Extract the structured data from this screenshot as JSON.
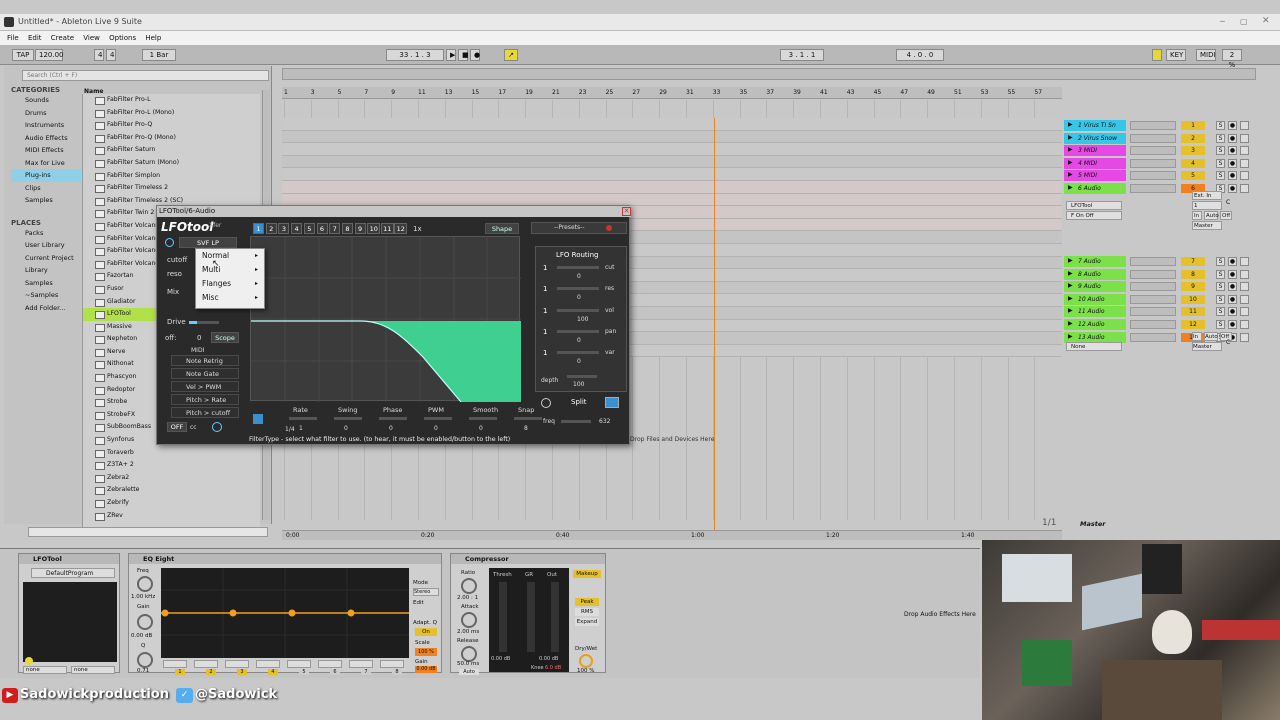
{
  "window": {
    "title": "Untitled* - Ableton Live 9 Suite"
  },
  "menu": [
    "File",
    "Edit",
    "Create",
    "View",
    "Options",
    "Help"
  ],
  "transport": {
    "tap": "TAP",
    "tempo": "120.00",
    "time_sig_num": "4",
    "time_sig_den": "4",
    "quant": "1 Bar",
    "pos": "33 . 1 . 3",
    "loop_start": "3 . 1 . 1",
    "loop_len": "4 . 0 . 0",
    "key": "KEY",
    "midi": "MIDI",
    "cpu": "2 %"
  },
  "browser": {
    "search_placeholder": "Search (Ctrl + F)",
    "categories_title": "CATEGORIES",
    "categories": [
      "Sounds",
      "Drums",
      "Instruments",
      "Audio Effects",
      "MIDI Effects",
      "Max for Live",
      "Plug-ins",
      "Clips",
      "Samples"
    ],
    "places_title": "PLACES",
    "places": [
      "Packs",
      "User Library",
      "Current Project",
      "Library",
      "Samples",
      "~Samples",
      "Add Folder..."
    ],
    "name_header": "Name",
    "items": [
      "FabFilter Pro-L",
      "FabFilter Pro-L (Mono)",
      "FabFilter Pro-Q",
      "FabFilter Pro-Q (Mono)",
      "FabFilter Saturn",
      "FabFilter Saturn (Mono)",
      "FabFilter Simplon",
      "FabFilter Timeless 2",
      "FabFilter Timeless 2 (SC)",
      "FabFilter Twin 2",
      "FabFilter Volcano",
      "FabFilter Volcano",
      "FabFilter Volcano",
      "FabFilter Volcano",
      "Fazortan",
      "Fusor",
      "Gladiator",
      "LFOTool",
      "Massive",
      "Nepheton",
      "Nerve",
      "Nithonat",
      "Phascyon",
      "Redoptor",
      "Strobe",
      "StrobeFX",
      "SubBoomBass",
      "Synforus",
      "Toraverb",
      "Z3TA+ 2",
      "Zebra2",
      "Zebralette",
      "Zebrify",
      "ZRev"
    ]
  },
  "arrangement": {
    "ruler_marks": [
      "1",
      "3",
      "5",
      "7",
      "9",
      "11",
      "13",
      "15",
      "17",
      "19",
      "21",
      "23",
      "25",
      "27",
      "29",
      "31",
      "33",
      "35",
      "37",
      "39",
      "41",
      "43",
      "45",
      "47",
      "49",
      "51",
      "53",
      "55",
      "57"
    ],
    "time_marks": [
      "0:00",
      "0:20",
      "0:40",
      "1:00",
      "1:20",
      "1:40"
    ],
    "drop_files": "Drop Files and Devices Here",
    "master_pos": "1/1",
    "master": "Master"
  },
  "tracks": [
    {
      "name": "1 Virus TI Sn",
      "num": "1",
      "color": "#35c6e8"
    },
    {
      "name": "2 Virus Snow",
      "num": "2",
      "color": "#35c6e8"
    },
    {
      "name": "3 MIDI",
      "num": "3",
      "color": "#e548e5"
    },
    {
      "name": "4 MIDI",
      "num": "4",
      "color": "#e548e5"
    },
    {
      "name": "5 MIDI",
      "num": "5",
      "color": "#e548e5"
    },
    {
      "name": "6 Audio",
      "num": "6",
      "color": "#7be04a"
    },
    {
      "name": "7 Audio",
      "num": "7",
      "color": "#7be04a"
    },
    {
      "name": "8 Audio",
      "num": "8",
      "color": "#7be04a"
    },
    {
      "name": "9 Audio",
      "num": "9",
      "color": "#7be04a"
    },
    {
      "name": "10 Audio",
      "num": "10",
      "color": "#7be04a"
    },
    {
      "name": "11 Audio",
      "num": "11",
      "color": "#7be04a"
    },
    {
      "name": "12 Audio",
      "num": "12",
      "color": "#7be04a"
    },
    {
      "name": "13 Audio",
      "num": "13",
      "color": "#7be04a"
    }
  ],
  "routing": {
    "ext_in": "Ext. In",
    "lfotool": "LFOTool",
    "one": "1",
    "f_on_off": "F On Off",
    "in": "In",
    "auto": "Auto",
    "off": "Off",
    "master": "Master",
    "none": "None",
    "c": "C"
  },
  "plugin": {
    "title": "LFOTool/6-Audio",
    "logo": "LFOtool",
    "filter": "SVF LP",
    "cutoff": "cutoff",
    "reso": "reso",
    "mix": "Mix",
    "drive": "Drive",
    "off_label": "off:",
    "off_val": "0",
    "scope": "Scope",
    "midi": "MIDI",
    "midi_items": [
      "Note Retrig",
      "Note Gate",
      "Vel > PWM",
      "Pitch > Rate",
      "Pitch > cutoff"
    ],
    "off_btn": "OFF",
    "cc": "cc",
    "pattern_tabs": [
      "1",
      "2",
      "3",
      "4",
      "5",
      "6",
      "7",
      "8",
      "9",
      "10",
      "11",
      "12"
    ],
    "speed": "1x",
    "shape": "Shape",
    "presets": "--Presets--",
    "lfo_routing": "LFO Routing",
    "route_rows": [
      {
        "n": "1",
        "l": "cut",
        "v": "0"
      },
      {
        "n": "1",
        "l": "res",
        "v": "0"
      },
      {
        "n": "1",
        "l": "vol",
        "v": "100"
      },
      {
        "n": "1",
        "l": "pan",
        "v": "0"
      },
      {
        "n": "1",
        "l": "var",
        "v": "0"
      }
    ],
    "depth": "depth",
    "depth_val": "100",
    "split": "Split",
    "freq": "freq",
    "freq_val": "632",
    "grid_val": "1/4",
    "knobs": [
      "Rate",
      "Swing",
      "Phase",
      "PWM",
      "Smooth",
      "Snap"
    ],
    "knob_vals": [
      "1",
      "0",
      "0",
      "0",
      "0",
      "8"
    ],
    "status": "FilterType - select what filter to use. (to hear, it must be enabled/button to the left)"
  },
  "context_menu": [
    "Normal",
    "Multi",
    "Flanges",
    "Misc"
  ],
  "devices": {
    "lfotool": {
      "name": "LFOTool",
      "program": "DefaultProgram",
      "none1": "none",
      "none2": "none"
    },
    "eq": {
      "name": "EQ Eight",
      "freq": "Freq",
      "freq_val": "1.00 kHz",
      "gain": "Gain",
      "gain_val": "0.00 dB",
      "q": "Q",
      "q_val": "0.71",
      "mode": "Mode",
      "mode_val": "Stereo",
      "edit": "Edit",
      "adapt": "Adapt. Q",
      "on": "On",
      "scale": "Scale",
      "scale_val": "100 %",
      "gain2": "Gain",
      "gain2_val": "0.00 dB",
      "bands": [
        "1",
        "2",
        "3",
        "4",
        "5",
        "6",
        "7",
        "8"
      ]
    },
    "comp": {
      "name": "Compressor",
      "ratio": "Ratio",
      "ratio_val": "2.00 : 1",
      "attack": "Attack",
      "attack_val": "2.00 ms",
      "release": "Release",
      "release_val": "50.0 ms",
      "auto": "Auto",
      "thresh": "Thresh",
      "gr": "GR",
      "out": "Out",
      "thresh_val": "0.00 dB",
      "out_val": "0.00 dB",
      "knee": "Knee",
      "knee_val": "6.0 dB",
      "makeup": "Makeup",
      "peak": "Peak",
      "rms": "RMS",
      "expand": "Expand",
      "drywet": "Dry/Wet",
      "drywet_val": "100 %"
    },
    "drop_effects": "Drop Audio Effects Here"
  },
  "social": {
    "youtube": "Sadowickproduction",
    "twitter": "@Sadowick"
  }
}
